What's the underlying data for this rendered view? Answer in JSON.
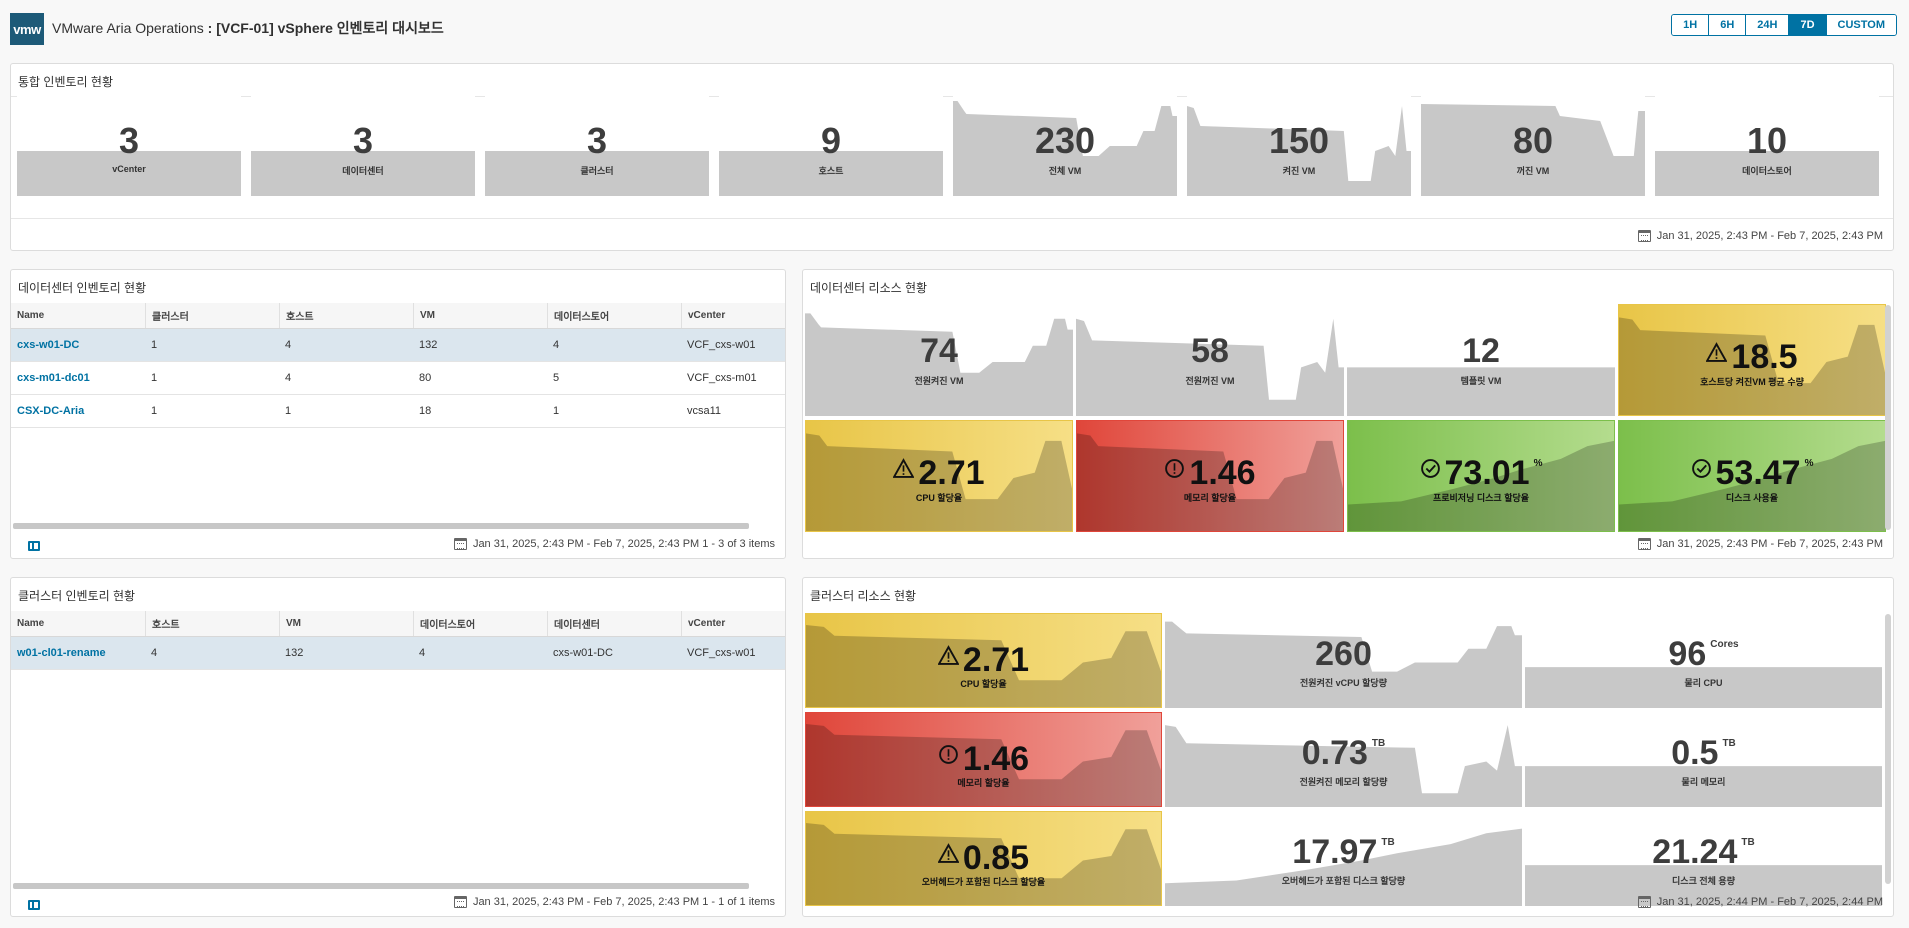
{
  "header": {
    "logo_text": "vmw",
    "app_name": "VMware Aria Operations",
    "separator": " : ",
    "dashboard_name": "[VCF-01] vSphere 인벤토리 대시보드",
    "time_buttons": [
      "1H",
      "6H",
      "24H",
      "7D",
      "CUSTOM"
    ],
    "active_time": "7D"
  },
  "inventory": {
    "title": "통합 인벤토리 현황",
    "tiles": [
      {
        "value": "3",
        "label": "vCenter"
      },
      {
        "value": "3",
        "label": "데이터센터"
      },
      {
        "value": "3",
        "label": "클러스터"
      },
      {
        "value": "9",
        "label": "호스트"
      },
      {
        "value": "230",
        "label": "전체 VM"
      },
      {
        "value": "150",
        "label": "켜진 VM"
      },
      {
        "value": "80",
        "label": "꺼진 VM"
      },
      {
        "value": "10",
        "label": "데이터스토어"
      }
    ],
    "footer": "Jan 31, 2025, 2:43 PM - Feb 7, 2025, 2:43 PM"
  },
  "dc_inventory": {
    "title": "데이터센터 인벤토리 현황",
    "columns": [
      "Name",
      "클러스터",
      "호스트",
      "VM",
      "데이터스토어",
      "vCenter"
    ],
    "rows": [
      [
        "cxs-w01-DC",
        "1",
        "4",
        "132",
        "4",
        "VCF_cxs-w01"
      ],
      [
        "cxs-m01-dc01",
        "1",
        "4",
        "80",
        "5",
        "VCF_cxs-m01"
      ],
      [
        "CSX-DC-Aria",
        "1",
        "1",
        "18",
        "1",
        "vcsa11"
      ]
    ],
    "footer": "Jan 31, 2025, 2:43 PM - Feb 7, 2025, 2:43 PM 1 - 3 of 3 items"
  },
  "dc_resource": {
    "title": "데이터센터 리소스 현황",
    "tiles": [
      {
        "value": "74",
        "label": "전원켜진 VM",
        "unit": "",
        "status": "none"
      },
      {
        "value": "58",
        "label": "전원꺼진 VM",
        "unit": "",
        "status": "none"
      },
      {
        "value": "12",
        "label": "템플릿 VM",
        "unit": "",
        "status": "none"
      },
      {
        "value": "18.5",
        "label": "호스트당 켜진VM 평균 수량",
        "unit": "",
        "status": "warning"
      },
      {
        "value": "2.71",
        "label": "CPU 할당율",
        "unit": "",
        "status": "warning"
      },
      {
        "value": "1.46",
        "label": "메모리 할당율",
        "unit": "",
        "status": "critical"
      },
      {
        "value": "73.01",
        "label": "프로비저닝 디스크 할당율",
        "unit": "%",
        "status": "ok"
      },
      {
        "value": "53.47",
        "label": "디스크 사용율",
        "unit": "%",
        "status": "ok"
      }
    ],
    "footer": "Jan 31, 2025, 2:43 PM - Feb 7, 2025, 2:43 PM"
  },
  "cluster_inventory": {
    "title": "클러스터 인벤토리 현황",
    "columns": [
      "Name",
      "호스트",
      "VM",
      "데이터스토어",
      "데이터센터",
      "vCenter"
    ],
    "rows": [
      [
        "w01-cl01-rename",
        "4",
        "132",
        "4",
        "cxs-w01-DC",
        "VCF_cxs-w01"
      ]
    ],
    "footer": "Jan 31, 2025, 2:43 PM - Feb 7, 2025, 2:43 PM 1 - 1 of 1 items"
  },
  "cluster_resource": {
    "title": "클러스터 리소스 현황",
    "tiles": [
      {
        "value": "2.71",
        "label": "CPU 할당율",
        "unit": "",
        "status": "warning"
      },
      {
        "value": "260",
        "label": "전원켜진 vCPU 할당량",
        "unit": "",
        "status": "none"
      },
      {
        "value": "96",
        "label": "물리 CPU",
        "unit": "Cores",
        "status": "none"
      },
      {
        "value": "1.46",
        "label": "메모리 할당율",
        "unit": "",
        "status": "critical"
      },
      {
        "value": "0.73",
        "label": "전원켜진 메모리 할당량",
        "unit": "TB",
        "status": "none"
      },
      {
        "value": "0.5",
        "label": "물리 메모리",
        "unit": "TB",
        "status": "none"
      },
      {
        "value": "0.85",
        "label": "오버헤드가 포함된 디스크 할당율",
        "unit": "",
        "status": "warning"
      },
      {
        "value": "17.97",
        "label": "오버헤드가 포함된 디스크 할당량",
        "unit": "TB",
        "status": "none"
      },
      {
        "value": "21.24",
        "label": "디스크 전체 용량",
        "unit": "TB",
        "status": "none"
      }
    ],
    "footer": "Jan 31, 2025, 2:44 PM - Feb 7, 2025, 2:44 PM"
  },
  "colors": {
    "accent": "#0072a3",
    "warning": "#e8c547",
    "critical": "#e0463a",
    "ok": "#7cbf4b",
    "neutral_spark": "#c8c8c8"
  }
}
